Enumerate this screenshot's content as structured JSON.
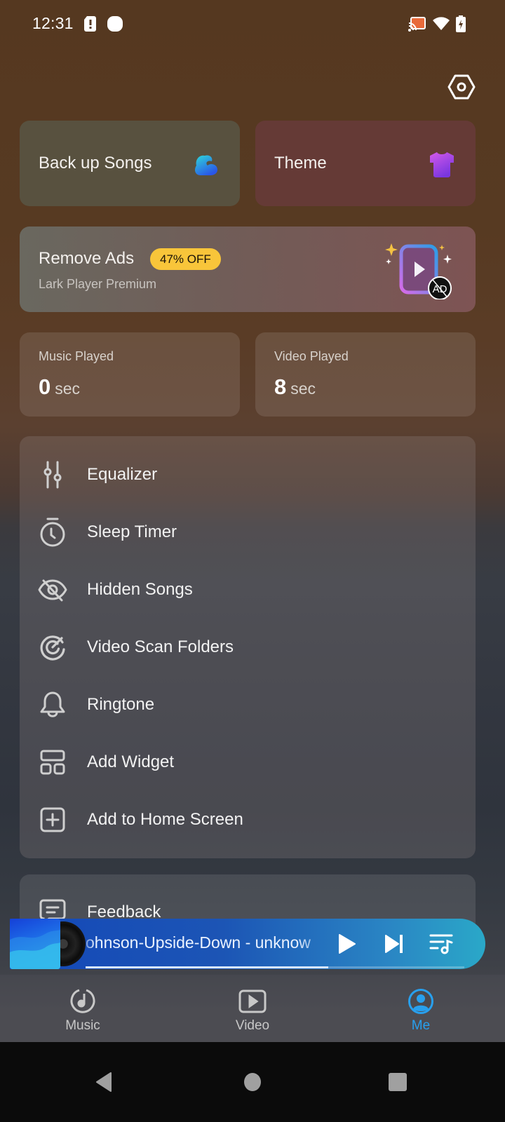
{
  "status_bar": {
    "time": "12:31",
    "left_icons": [
      "sim-alert-icon",
      "notification-dot-icon"
    ],
    "right_icons": [
      "cast-icon",
      "wifi-icon",
      "battery-charging-icon"
    ]
  },
  "header": {
    "settings_icon": "settings-hex-icon"
  },
  "quick_cards": [
    {
      "label": "Back up Songs",
      "icon": "cloud-icon"
    },
    {
      "label": "Theme",
      "icon": "tshirt-icon"
    }
  ],
  "promo": {
    "title": "Remove Ads",
    "badge": "47% OFF",
    "subtitle": "Lark Player Premium",
    "icon": "no-ads-icon",
    "badge_color": "#f8c53a"
  },
  "stats": [
    {
      "label": "Music Played",
      "value": "0",
      "unit": "sec"
    },
    {
      "label": "Video Played",
      "value": "8",
      "unit": "sec"
    }
  ],
  "menu": [
    {
      "label": "Equalizer",
      "icon": "equalizer-icon"
    },
    {
      "label": "Sleep Timer",
      "icon": "timer-icon"
    },
    {
      "label": "Hidden Songs",
      "icon": "eye-off-icon"
    },
    {
      "label": "Video Scan Folders",
      "icon": "scan-icon"
    },
    {
      "label": "Ringtone",
      "icon": "bell-icon"
    },
    {
      "label": "Add Widget",
      "icon": "widget-icon"
    },
    {
      "label": "Add to Home Screen",
      "icon": "add-box-icon"
    }
  ],
  "menu2": [
    {
      "label": "Feedback",
      "icon": "feedback-icon"
    }
  ],
  "mini_player": {
    "title": "ohnson-Upside-Down - unknow",
    "progress": 0.64,
    "controls": [
      "play-icon",
      "skip-next-icon",
      "playlist-icon"
    ]
  },
  "bottom_nav": {
    "items": [
      {
        "label": "Music",
        "icon": "music-disc-icon",
        "active": false
      },
      {
        "label": "Video",
        "icon": "video-icon",
        "active": false
      },
      {
        "label": "Me",
        "icon": "profile-icon",
        "active": true
      }
    ],
    "active_color": "#28a0ee"
  },
  "system_nav": [
    "back-icon",
    "home-icon",
    "recents-icon"
  ]
}
